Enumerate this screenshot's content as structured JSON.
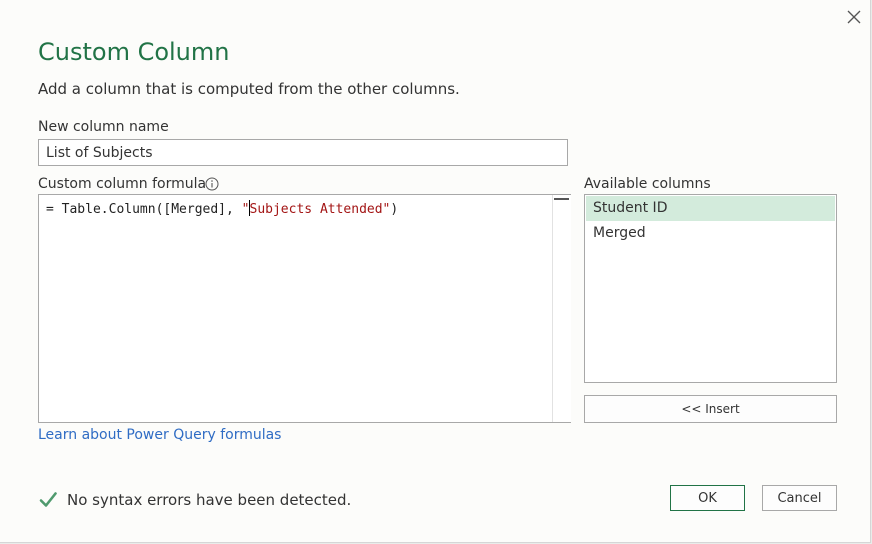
{
  "dialog": {
    "title": "Custom Column",
    "subtitle": "Add a column that is computed from the other columns.",
    "close_icon": "close-icon"
  },
  "new_column": {
    "label": "New column name",
    "value": "List of Subjects"
  },
  "formula": {
    "label": "Custom column formula",
    "info_icon": "info-icon",
    "text_before": "= Table.Column([Merged], ",
    "string_before_caret": "\"",
    "string_after_caret": "Subjects Attended\"",
    "text_after": ")"
  },
  "available_columns": {
    "label": "Available columns",
    "items": [
      {
        "label": "Student ID",
        "selected": true
      },
      {
        "label": "Merged",
        "selected": false
      }
    ],
    "insert_label": "<< Insert"
  },
  "learn_link": "Learn about Power Query formulas",
  "status": {
    "icon": "checkmark-icon",
    "text": "No syntax errors have been detected."
  },
  "buttons": {
    "ok": "OK",
    "cancel": "Cancel"
  },
  "colors": {
    "accent": "#217346",
    "selection": "#d3ebdc",
    "link": "#2f6cc4",
    "string": "#a31515"
  }
}
